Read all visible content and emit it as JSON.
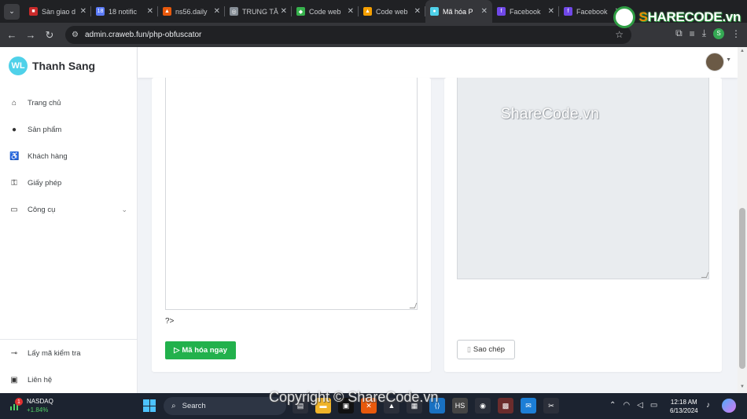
{
  "browser": {
    "tabs": [
      {
        "title": "Sàn giao d",
        "icon_color": "#c92a2a",
        "icon": "■"
      },
      {
        "title": "18 notific",
        "icon_color": "#5c7cfa",
        "icon": "18"
      },
      {
        "title": "ns56.daily",
        "icon_color": "#e8590c",
        "icon": "▲"
      },
      {
        "title": "TRUNG TÂ",
        "icon_color": "#868e96",
        "icon": "◎"
      },
      {
        "title": "Code web",
        "icon_color": "#37b24d",
        "icon": "◆"
      },
      {
        "title": "Code web",
        "icon_color": "#f59f00",
        "icon": "▲"
      },
      {
        "title": "Mã hóa P",
        "icon_color": "#4fd1e9",
        "icon": "●"
      },
      {
        "title": "Facebook",
        "icon_color": "#7048e8",
        "icon": "f"
      },
      {
        "title": "Facebook",
        "icon_color": "#7048e8",
        "icon": "f"
      }
    ],
    "url": "admin.craweb.fun/php-obfuscator",
    "profile_initial": "S"
  },
  "watermark": {
    "logo_prefix": "S",
    "logo_text": "HARECODE.vn",
    "center_text": "ShareCode.vn",
    "bottom_text": "Copyright © ShareCode.vn"
  },
  "sidebar": {
    "brand_logo": "WL",
    "brand_name": "Thanh Sang",
    "items": [
      {
        "label": "Trang chủ",
        "icon": "home-icon",
        "glyph": "⌂"
      },
      {
        "label": "Sản phẩm",
        "icon": "product-icon",
        "glyph": "●"
      },
      {
        "label": "Khách hàng",
        "icon": "customer-icon",
        "glyph": "♿"
      },
      {
        "label": "Giấy phép",
        "icon": "license-icon",
        "glyph": "⚿"
      },
      {
        "label": "Công cụ",
        "icon": "toolbox-icon",
        "glyph": "▭",
        "has_submenu": true
      }
    ],
    "bottom_items": [
      {
        "label": "Lấy mã kiểm tra",
        "icon": "key-icon",
        "glyph": "⊸"
      },
      {
        "label": "Liên hệ",
        "icon": "contact-icon",
        "glyph": "▣"
      }
    ]
  },
  "main": {
    "code_tail": "?>",
    "encrypt_button": "Mã hóa ngay",
    "copy_button": "Sao chép"
  },
  "taskbar": {
    "ticker_name": "NASDAQ",
    "ticker_change": "+1.84%",
    "notification_count": "1",
    "search_label": "Search",
    "time": "12:18 AM",
    "date": "6/13/2024"
  }
}
